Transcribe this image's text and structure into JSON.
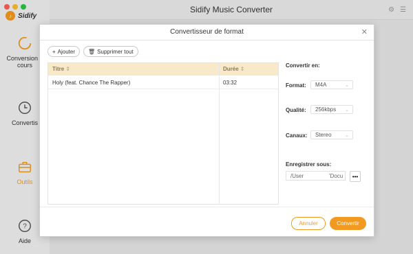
{
  "app": {
    "title": "Sidify Music Converter",
    "brand": "Sidify"
  },
  "sidebar": {
    "items": [
      {
        "label": "Conversion e",
        "label2": "cours",
        "icon": "circle-progress-icon"
      },
      {
        "label": "Convertis",
        "icon": "clock-icon"
      },
      {
        "label": "Outils",
        "icon": "toolbox-icon",
        "active": true
      },
      {
        "label": "Aide",
        "icon": "help-icon"
      }
    ]
  },
  "modal": {
    "title": "Convertisseur de format",
    "add_label": "Ajouter",
    "delete_all_label": "Supprimer tout",
    "table": {
      "columns": [
        "Titre",
        "Durée"
      ],
      "rows": [
        {
          "title": "Holy (feat. Chance The Rapper)",
          "duration": "03:32"
        }
      ]
    },
    "settings": {
      "header": "Convertir en:",
      "format_label": "Format:",
      "format_value": "M4A",
      "quality_label": "Qualité:",
      "quality_value": "256kbps",
      "channels_label": "Canaux:",
      "channels_value": "Stereo",
      "save_label": "Enregistrer sous:",
      "path_part1": "/User",
      "path_part2": "'Docu",
      "browse_label": "•••"
    },
    "cancel_label": "Annuler",
    "convert_label": "Convertir"
  },
  "colors": {
    "accent": "#f29a1f",
    "header_bg": "#f8e9c8"
  }
}
